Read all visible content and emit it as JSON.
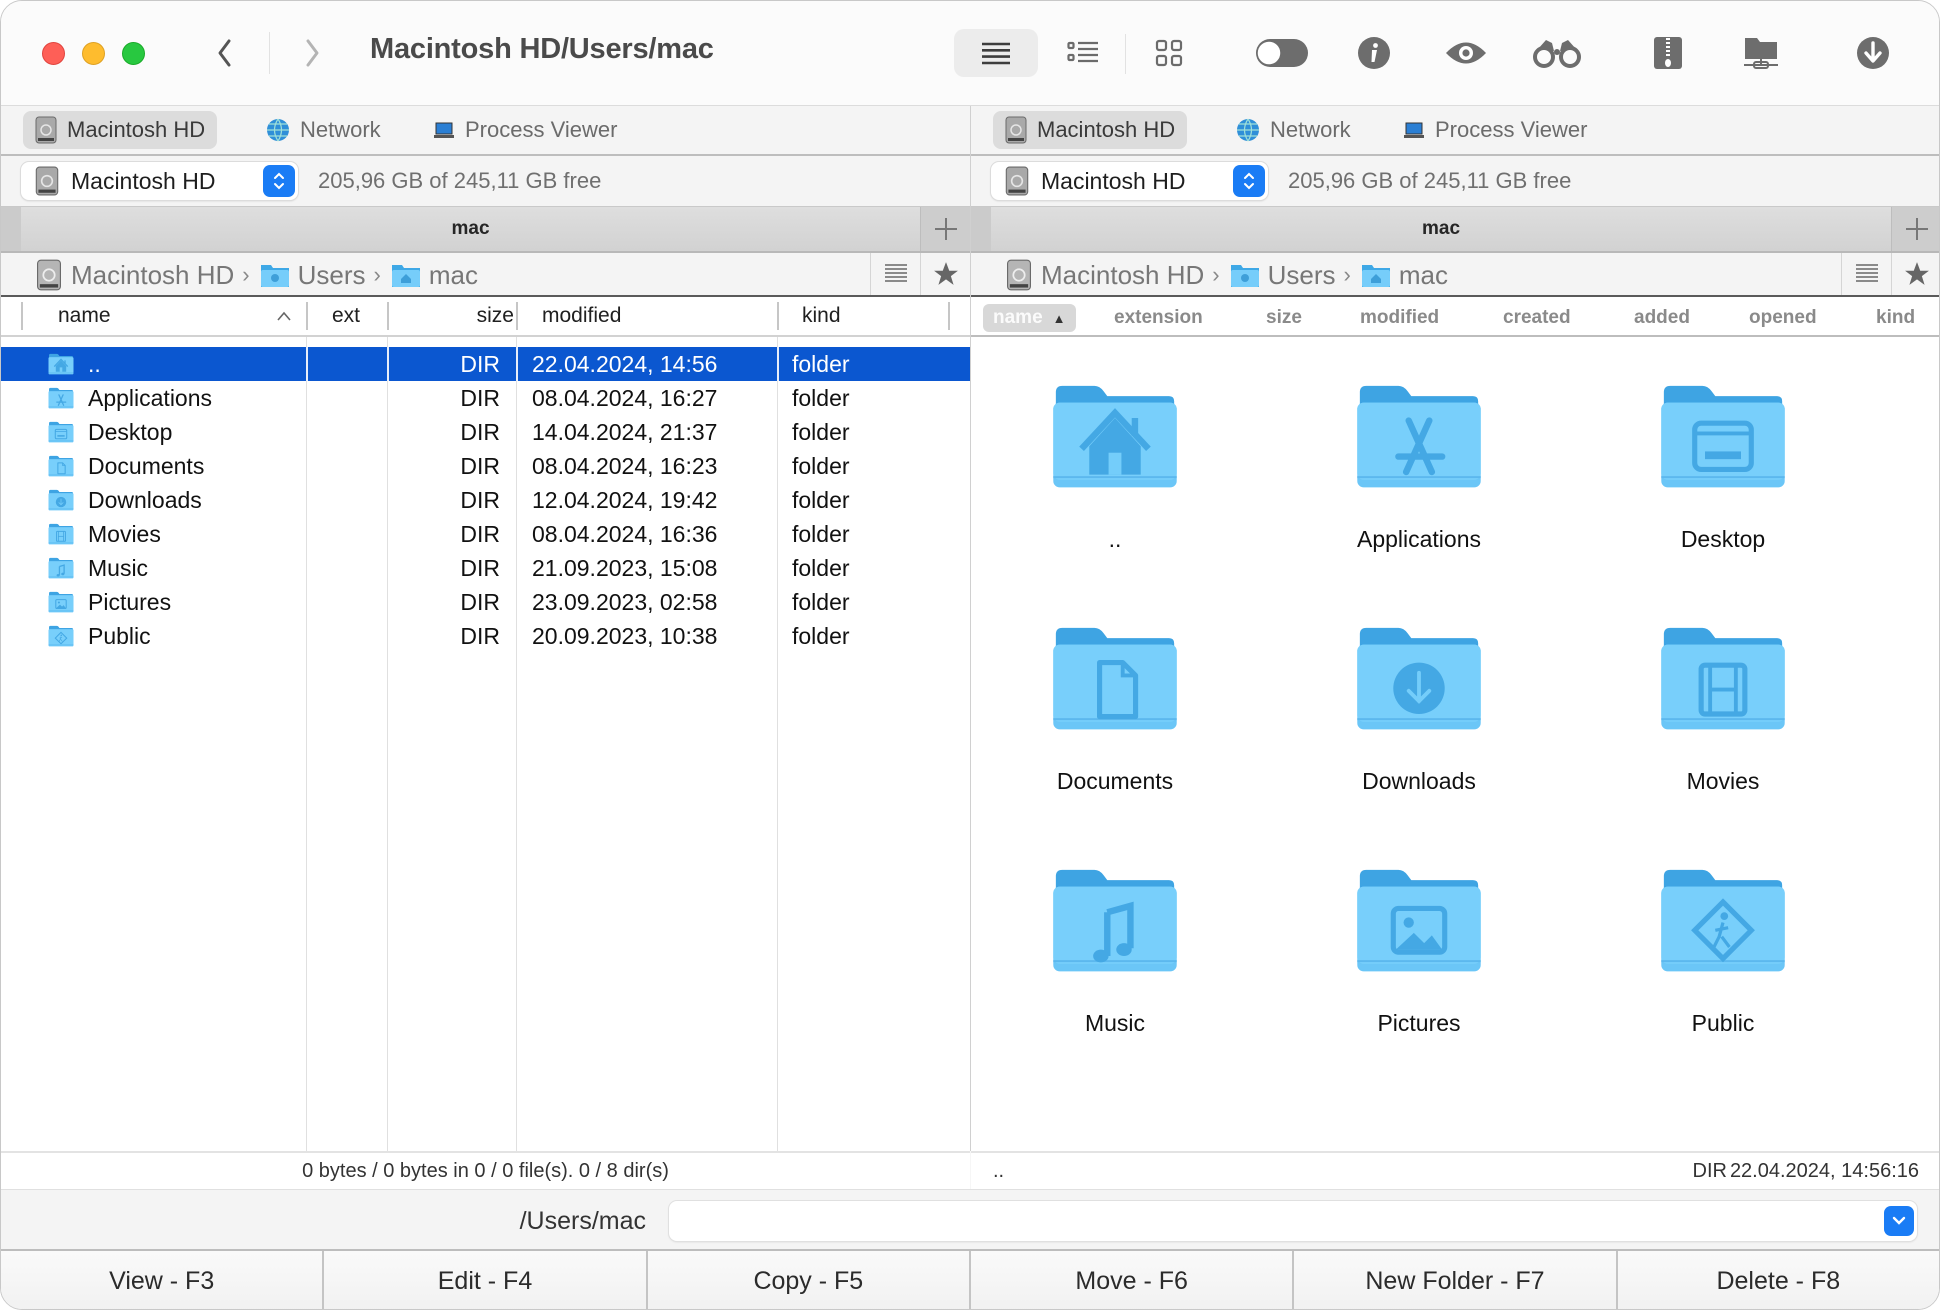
{
  "window": {
    "title": "Macintosh HD/Users/mac"
  },
  "toolbar": {
    "buttons": [
      {
        "name": "brief-view",
        "icon": "list-lines-icon",
        "active": true
      },
      {
        "name": "full-view",
        "icon": "detailed-list-icon",
        "active": false
      },
      {
        "name": "thumbnail-view",
        "icon": "grid-icon",
        "active": false
      },
      {
        "name": "hidden-files-toggle",
        "icon": "toggle-icon",
        "active": false
      },
      {
        "name": "info",
        "icon": "info-icon",
        "active": false
      },
      {
        "name": "quick-view",
        "icon": "eye-icon",
        "active": false
      },
      {
        "name": "search",
        "icon": "binoculars-icon",
        "active": false
      },
      {
        "name": "archive",
        "icon": "zip-icon",
        "active": false
      },
      {
        "name": "network-folder",
        "icon": "network-folder-icon",
        "active": false
      },
      {
        "name": "download",
        "icon": "download-circle-icon",
        "active": false
      }
    ]
  },
  "left_pane": {
    "drive_tabs": [
      {
        "label": "Macintosh HD",
        "icon": "hard-drive-icon",
        "active": true
      },
      {
        "label": "Network",
        "icon": "globe-icon",
        "active": false
      },
      {
        "label": "Process Viewer",
        "icon": "laptop-icon",
        "active": false
      }
    ],
    "drive_select": {
      "value": "Macintosh HD"
    },
    "free_space": "205,96 GB of 245,11 GB free",
    "tab_title": "mac",
    "breadcrumb": [
      {
        "label": "Macintosh HD",
        "icon": "hard-drive-icon"
      },
      {
        "label": "Users",
        "icon": "users-folder-icon"
      },
      {
        "label": "mac",
        "icon": "home-folder-icon"
      }
    ],
    "columns": {
      "name": "name",
      "ext": "ext",
      "size": "size",
      "modified": "modified",
      "kind": "kind"
    },
    "sort": {
      "column": "name",
      "direction": "ascending"
    },
    "rows": [
      {
        "name": "..",
        "ext": "",
        "size": "DIR",
        "modified": "22.04.2024, 14:56",
        "kind": "folder",
        "icon": "home",
        "selected": true
      },
      {
        "name": "Applications",
        "ext": "",
        "size": "DIR",
        "modified": "08.04.2024, 16:27",
        "kind": "folder",
        "icon": "apps",
        "selected": false
      },
      {
        "name": "Desktop",
        "ext": "",
        "size": "DIR",
        "modified": "14.04.2024, 21:37",
        "kind": "folder",
        "icon": "desktop",
        "selected": false
      },
      {
        "name": "Documents",
        "ext": "",
        "size": "DIR",
        "modified": "08.04.2024, 16:23",
        "kind": "folder",
        "icon": "doc",
        "selected": false
      },
      {
        "name": "Downloads",
        "ext": "",
        "size": "DIR",
        "modified": "12.04.2024, 19:42",
        "kind": "folder",
        "icon": "download",
        "selected": false
      },
      {
        "name": "Movies",
        "ext": "",
        "size": "DIR",
        "modified": "08.04.2024, 16:36",
        "kind": "folder",
        "icon": "film",
        "selected": false
      },
      {
        "name": "Music",
        "ext": "",
        "size": "DIR",
        "modified": "21.09.2023, 15:08",
        "kind": "folder",
        "icon": "music",
        "selected": false
      },
      {
        "name": "Pictures",
        "ext": "",
        "size": "DIR",
        "modified": "23.09.2023, 02:58",
        "kind": "folder",
        "icon": "picture",
        "selected": false
      },
      {
        "name": "Public",
        "ext": "",
        "size": "DIR",
        "modified": "20.09.2023, 10:38",
        "kind": "folder",
        "icon": "public",
        "selected": false
      }
    ],
    "status": "0 bytes / 0 bytes in 0 / 0 file(s). 0 / 8 dir(s)"
  },
  "right_pane": {
    "drive_tabs": [
      {
        "label": "Macintosh HD",
        "icon": "hard-drive-icon",
        "active": true
      },
      {
        "label": "Network",
        "icon": "globe-icon",
        "active": false
      },
      {
        "label": "Process Viewer",
        "icon": "laptop-icon",
        "active": false
      }
    ],
    "drive_select": {
      "value": "Macintosh HD"
    },
    "free_space": "205,96 GB of 245,11 GB free",
    "tab_title": "mac",
    "breadcrumb": [
      {
        "label": "Macintosh HD",
        "icon": "hard-drive-icon"
      },
      {
        "label": "Users",
        "icon": "users-folder-icon"
      },
      {
        "label": "mac",
        "icon": "home-folder-icon"
      }
    ],
    "columns": [
      "name",
      "extension",
      "size",
      "modified",
      "created",
      "added",
      "opened",
      "kind"
    ],
    "sort": {
      "column": "name",
      "direction": "ascending",
      "indicator": "▲"
    },
    "items": [
      {
        "name": "..",
        "icon": "home"
      },
      {
        "name": "Applications",
        "icon": "apps"
      },
      {
        "name": "Desktop",
        "icon": "desktop"
      },
      {
        "name": "Documents",
        "icon": "doc"
      },
      {
        "name": "Downloads",
        "icon": "download"
      },
      {
        "name": "Movies",
        "icon": "film"
      },
      {
        "name": "Music",
        "icon": "music"
      },
      {
        "name": "Pictures",
        "icon": "picture"
      },
      {
        "name": "Public",
        "icon": "public"
      }
    ],
    "status": {
      "name": "..",
      "size": "DIR",
      "date": "22.04.2024, 14:56:16"
    }
  },
  "command_line": {
    "path": "/Users/mac",
    "value": "",
    "placeholder": ""
  },
  "function_keys": [
    {
      "label": "View - F3"
    },
    {
      "label": "Edit - F4"
    },
    {
      "label": "Copy - F5"
    },
    {
      "label": "Move - F6"
    },
    {
      "label": "New Folder - F7"
    },
    {
      "label": "Delete - F8"
    }
  ],
  "colors": {
    "selection": "#0b57d0",
    "accent": "#1a7cf5",
    "folder_light": "#74cdfa",
    "folder_dark": "#42a5e0"
  }
}
